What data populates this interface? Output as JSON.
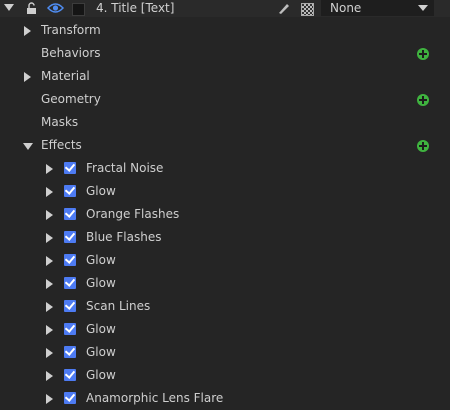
{
  "header": {
    "title": "4. Title [Text]",
    "blend_mode": "None"
  },
  "categories": [
    {
      "label": "Transform",
      "expander": "right",
      "add": false
    },
    {
      "label": "Behaviors",
      "expander": "none",
      "add": true
    },
    {
      "label": "Material",
      "expander": "right",
      "add": false
    },
    {
      "label": "Geometry",
      "expander": "none",
      "add": true
    },
    {
      "label": "Masks",
      "expander": "none",
      "add": false
    },
    {
      "label": "Effects",
      "expander": "down",
      "add": true
    }
  ],
  "effects": [
    {
      "label": "Fractal Noise",
      "enabled": true
    },
    {
      "label": "Glow",
      "enabled": true
    },
    {
      "label": "Orange Flashes",
      "enabled": true
    },
    {
      "label": "Blue Flashes",
      "enabled": true
    },
    {
      "label": "Glow",
      "enabled": true
    },
    {
      "label": "Glow",
      "enabled": true
    },
    {
      "label": "Scan Lines",
      "enabled": true
    },
    {
      "label": "Glow",
      "enabled": true
    },
    {
      "label": "Glow",
      "enabled": true
    },
    {
      "label": "Glow",
      "enabled": true
    },
    {
      "label": "Anamorphic Lens Flare",
      "enabled": true
    }
  ],
  "colors": {
    "background": "#252525",
    "add_button": "#3fb33f",
    "checkbox": "#4d7bf3",
    "eye": "#4f8cf0"
  }
}
